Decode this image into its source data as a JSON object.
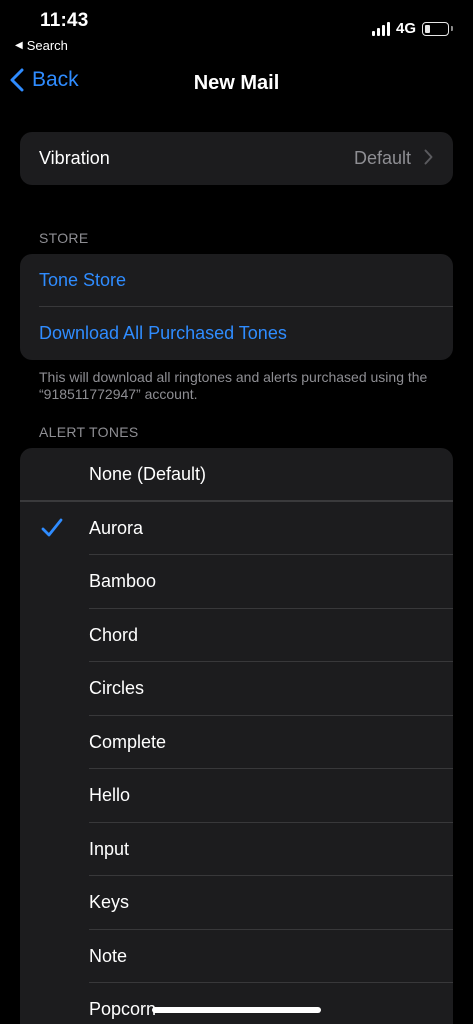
{
  "status_bar": {
    "time": "11:43",
    "back_app": "Search",
    "network": "4G"
  },
  "nav": {
    "back_label": "Back",
    "title": "New Mail"
  },
  "vibration": {
    "label": "Vibration",
    "value": "Default"
  },
  "store": {
    "header": "STORE",
    "tone_store": "Tone Store",
    "download_all": "Download All Purchased Tones",
    "note": "This will download all ringtones and alerts purchased using the “918511772947” account."
  },
  "alert_tones": {
    "header": "ALERT TONES",
    "selected": "Aurora",
    "items": [
      "None (Default)",
      "Aurora",
      "Bamboo",
      "Chord",
      "Circles",
      "Complete",
      "Hello",
      "Input",
      "Keys",
      "Note",
      "Popcorn"
    ]
  },
  "colors": {
    "accent": "#2f8cff",
    "background": "#000000",
    "cell": "#1c1c1e",
    "secondary_text": "#8e8e93"
  }
}
